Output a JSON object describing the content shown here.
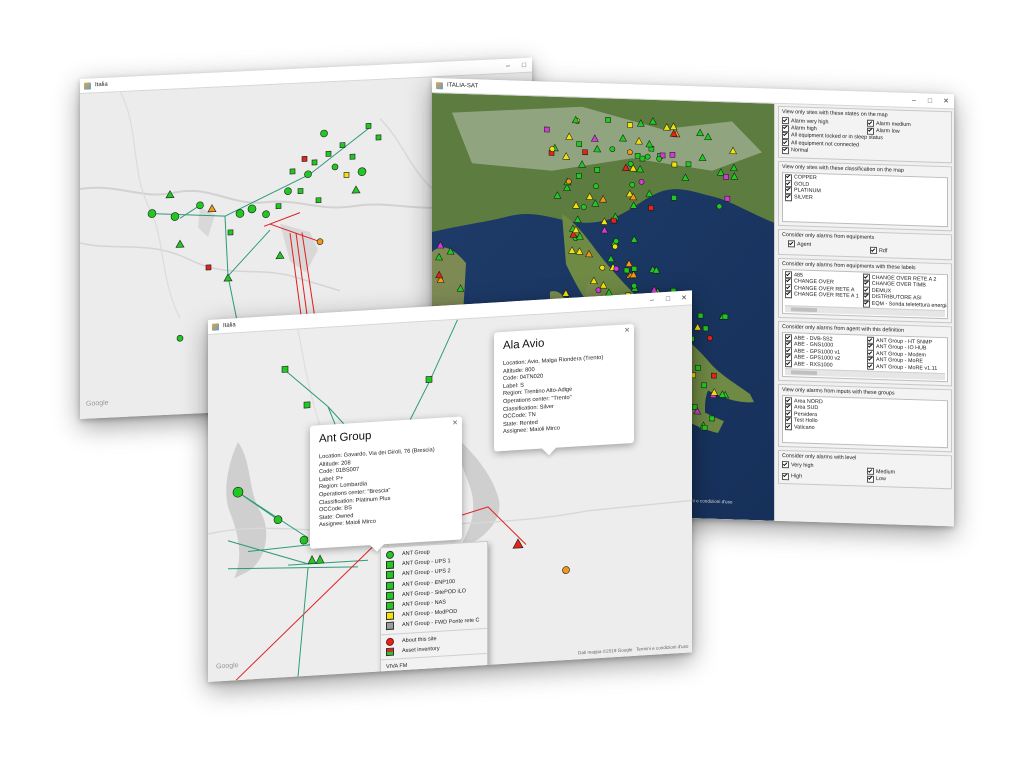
{
  "colors": {
    "green": "#22c822",
    "yellow": "#f2e10c",
    "orange": "#f29a16",
    "red": "#e0251b",
    "magenta": "#d43ad6",
    "gray": "#9c9c9c",
    "teal_route": "#2e9b78",
    "red_route": "#e21e1e"
  },
  "window_italia": {
    "title": "Italia",
    "map_credit": "Google"
  },
  "window_sat": {
    "title": "ITALIA-SAT",
    "map_footer": "Termini e condizioni d'uso",
    "states_section": {
      "title": "View only sites with these states on the map",
      "items": [
        {
          "label": "Alarm very high",
          "checked": true
        },
        {
          "label": "Alarm medium",
          "checked": true
        },
        {
          "label": "Alarm high",
          "checked": true
        },
        {
          "label": "Alarm low",
          "checked": true
        },
        {
          "label": "All equipment locked or in sleep status",
          "checked": true
        },
        {
          "label": "All equipment not connected",
          "checked": true
        },
        {
          "label": "Normal",
          "checked": true
        }
      ]
    },
    "classification_section": {
      "title": "View only sites with these classification on the map",
      "items": [
        "COPPER",
        "GOLD",
        "PLATINUM",
        "SILVER"
      ]
    },
    "equipment_section": {
      "title": "Consider only  alarms from equipments",
      "items": [
        {
          "label": "Agent",
          "checked": true
        },
        {
          "label": "Rdf",
          "checked": true
        }
      ]
    },
    "labels_section": {
      "title": "Consider only alarms from equipments with these labels",
      "items": [
        "485",
        "CHANGE OVER",
        "CHANGE OVER RETE A",
        "CHANGE OVER RETE A 1",
        "CHANGE OVER RETE A 2",
        "CHANGE OVER TIMB",
        "DEMUX",
        "DISTRIBUTORE ASI",
        "EQM - Sonda teletettura energia"
      ]
    },
    "agent_section": {
      "title": "Consider only alarms from agent with this definition",
      "items": [
        "ABE - DVB-SS2",
        "ABE - GNS1000",
        "ABE - GPS1000 v1",
        "ABE - GPS1000 v2",
        "ABE - RXS1000",
        "ANT Group - HT SNMP",
        "ANT Group - IO HUB",
        "ANT Group - Modem",
        "ANT Group - MoRE",
        "ANT Group - MoRE v1.11"
      ]
    },
    "groups_section": {
      "title": "View only alarms from inputs with these groups",
      "items": [
        "Area NORD",
        "Area SUD",
        "Persidera",
        "Test Hollo",
        "Vaticano"
      ]
    },
    "level_section": {
      "title": "Consider only alarms with level",
      "items": [
        {
          "label": "Very high",
          "checked": true
        },
        {
          "label": "Medium",
          "checked": true
        },
        {
          "label": "High",
          "checked": true
        },
        {
          "label": "Low",
          "checked": true
        }
      ]
    }
  },
  "window_front": {
    "title": "Italia",
    "map_credit": "Google",
    "map_footer_data": "Dati mappa ©2019 Google",
    "map_footer_terms": "Termini e condizioni d'uso",
    "popup_ant": {
      "title": "Ant Group",
      "lines": [
        "Location: Gavardo, Via dei Giroli, 76 (Brescia)",
        "Altitude: 208",
        "Code: 01BS007",
        "Label: P+",
        "Region: Lombardia",
        "Operations center: \"Brescia\"",
        "Classification: Platinum Plus",
        "OCCode: BS",
        "State: Owned",
        "Assignee: Maioli Mirco"
      ]
    },
    "popup_avio": {
      "title": "Ala Avio",
      "lines": [
        "Location: Avio, Malga Riondera (Trento)",
        "Altitude: 800",
        "Code: 04TN020",
        "Label: S",
        "Region: Trentino Alto-Adige",
        "Operations center: \"Trento\"",
        "Classification: Silver",
        "OCCode: TN",
        "State: Rented",
        "Assignee: Maioli Mirco"
      ]
    },
    "context_menu": {
      "items": [
        {
          "label": "ANT Group",
          "icon": "green-circle-icon",
          "color": "#22c822"
        },
        {
          "label": "ANT Group - UPS 1",
          "icon": "green-square-icon",
          "color": "#22c822"
        },
        {
          "label": "ANT Group - UPS 2",
          "icon": "green-square-icon",
          "color": "#22c822"
        },
        {
          "label": "ANT Group - ENP100",
          "icon": "green-square-icon",
          "color": "#22c822"
        },
        {
          "label": "ANT Group - SitePOD iLO",
          "icon": "green-square-icon",
          "color": "#22c822"
        },
        {
          "label": "ANT Group - NAS",
          "icon": "green-square-icon",
          "color": "#22c822"
        },
        {
          "label": "ANT Group - ModPOD",
          "icon": "yellow-square-icon",
          "color": "#f2e10c"
        },
        {
          "label": "ANT Group - FWD Ponte rete C",
          "icon": "gray-square-icon",
          "color": "#9c9c9c"
        }
      ],
      "actions": [
        {
          "label": "About this site",
          "icon": "info-icon"
        },
        {
          "label": "Asset inventory",
          "icon": "inventory-icon"
        }
      ],
      "extra": "VIVA FM"
    }
  }
}
